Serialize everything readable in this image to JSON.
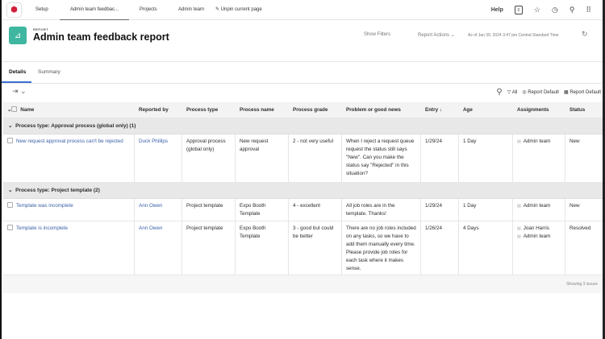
{
  "nav": {
    "tabs": [
      "Setup",
      "Admin team feedbac...",
      "Projects",
      "Admin team"
    ],
    "unpin": "Unpin current page",
    "help": "Help",
    "badge": "0"
  },
  "header": {
    "eyebrow": "REPORT",
    "title": "Admin team feedback report",
    "show_filters": "Show Filters",
    "report_actions": "Report Actions",
    "timestamp": "As of Jan 30, 2024 3:47 pm Central Standard Time"
  },
  "tabs": [
    "Details",
    "Summary"
  ],
  "toolbar": {
    "filter": "All",
    "view": "Report Default",
    "grouping": "Report Default"
  },
  "columns": [
    "Name",
    "Reported by",
    "Process type",
    "Process name",
    "Process grade",
    "Problem or good news",
    "Entry ↓",
    "Age",
    "Assignments",
    "Status"
  ],
  "groups": [
    {
      "label": "Process type: Approval process (global only) (1)",
      "rows": [
        {
          "name": "New request approval process can't be rejected",
          "reported_by": "Duck Phillips",
          "process_type": "Approval process (global only)",
          "process_name": "New request approval",
          "grade": "2 - not very useful",
          "problem": "When I reject a request queue request the status still says \"New\". Can you make the status say \"Rejected\" in this situation?",
          "entry": "1/29/24",
          "age": "1 Day",
          "assignments": [
            "Admin team"
          ],
          "status": "New"
        }
      ]
    },
    {
      "label": "Process type: Project template (2)",
      "rows": [
        {
          "name": "Template was incomplete",
          "reported_by": "Ann Owen",
          "process_type": "Project template",
          "process_name": "Expo Booth Template",
          "grade": "4 - excellent",
          "problem": "All job roles are in the template. Thanks!",
          "entry": "1/29/24",
          "age": "1 Day",
          "assignments": [
            "Admin team"
          ],
          "status": "New"
        },
        {
          "name": "Template is incomplete",
          "reported_by": "Ann Owen",
          "process_type": "Project template",
          "process_name": "Expo Booth Template",
          "grade": "3 - good but could be better",
          "problem": "There are no job roles included on any tasks, so we have to add them manually every time. Please provide job roles for each task where it makes sense.",
          "entry": "1/26/24",
          "age": "4 Days",
          "assignments": [
            "Joan Harris",
            "Admin team"
          ],
          "status": "Resolved"
        }
      ]
    }
  ],
  "footer": "Showing 3 issues"
}
